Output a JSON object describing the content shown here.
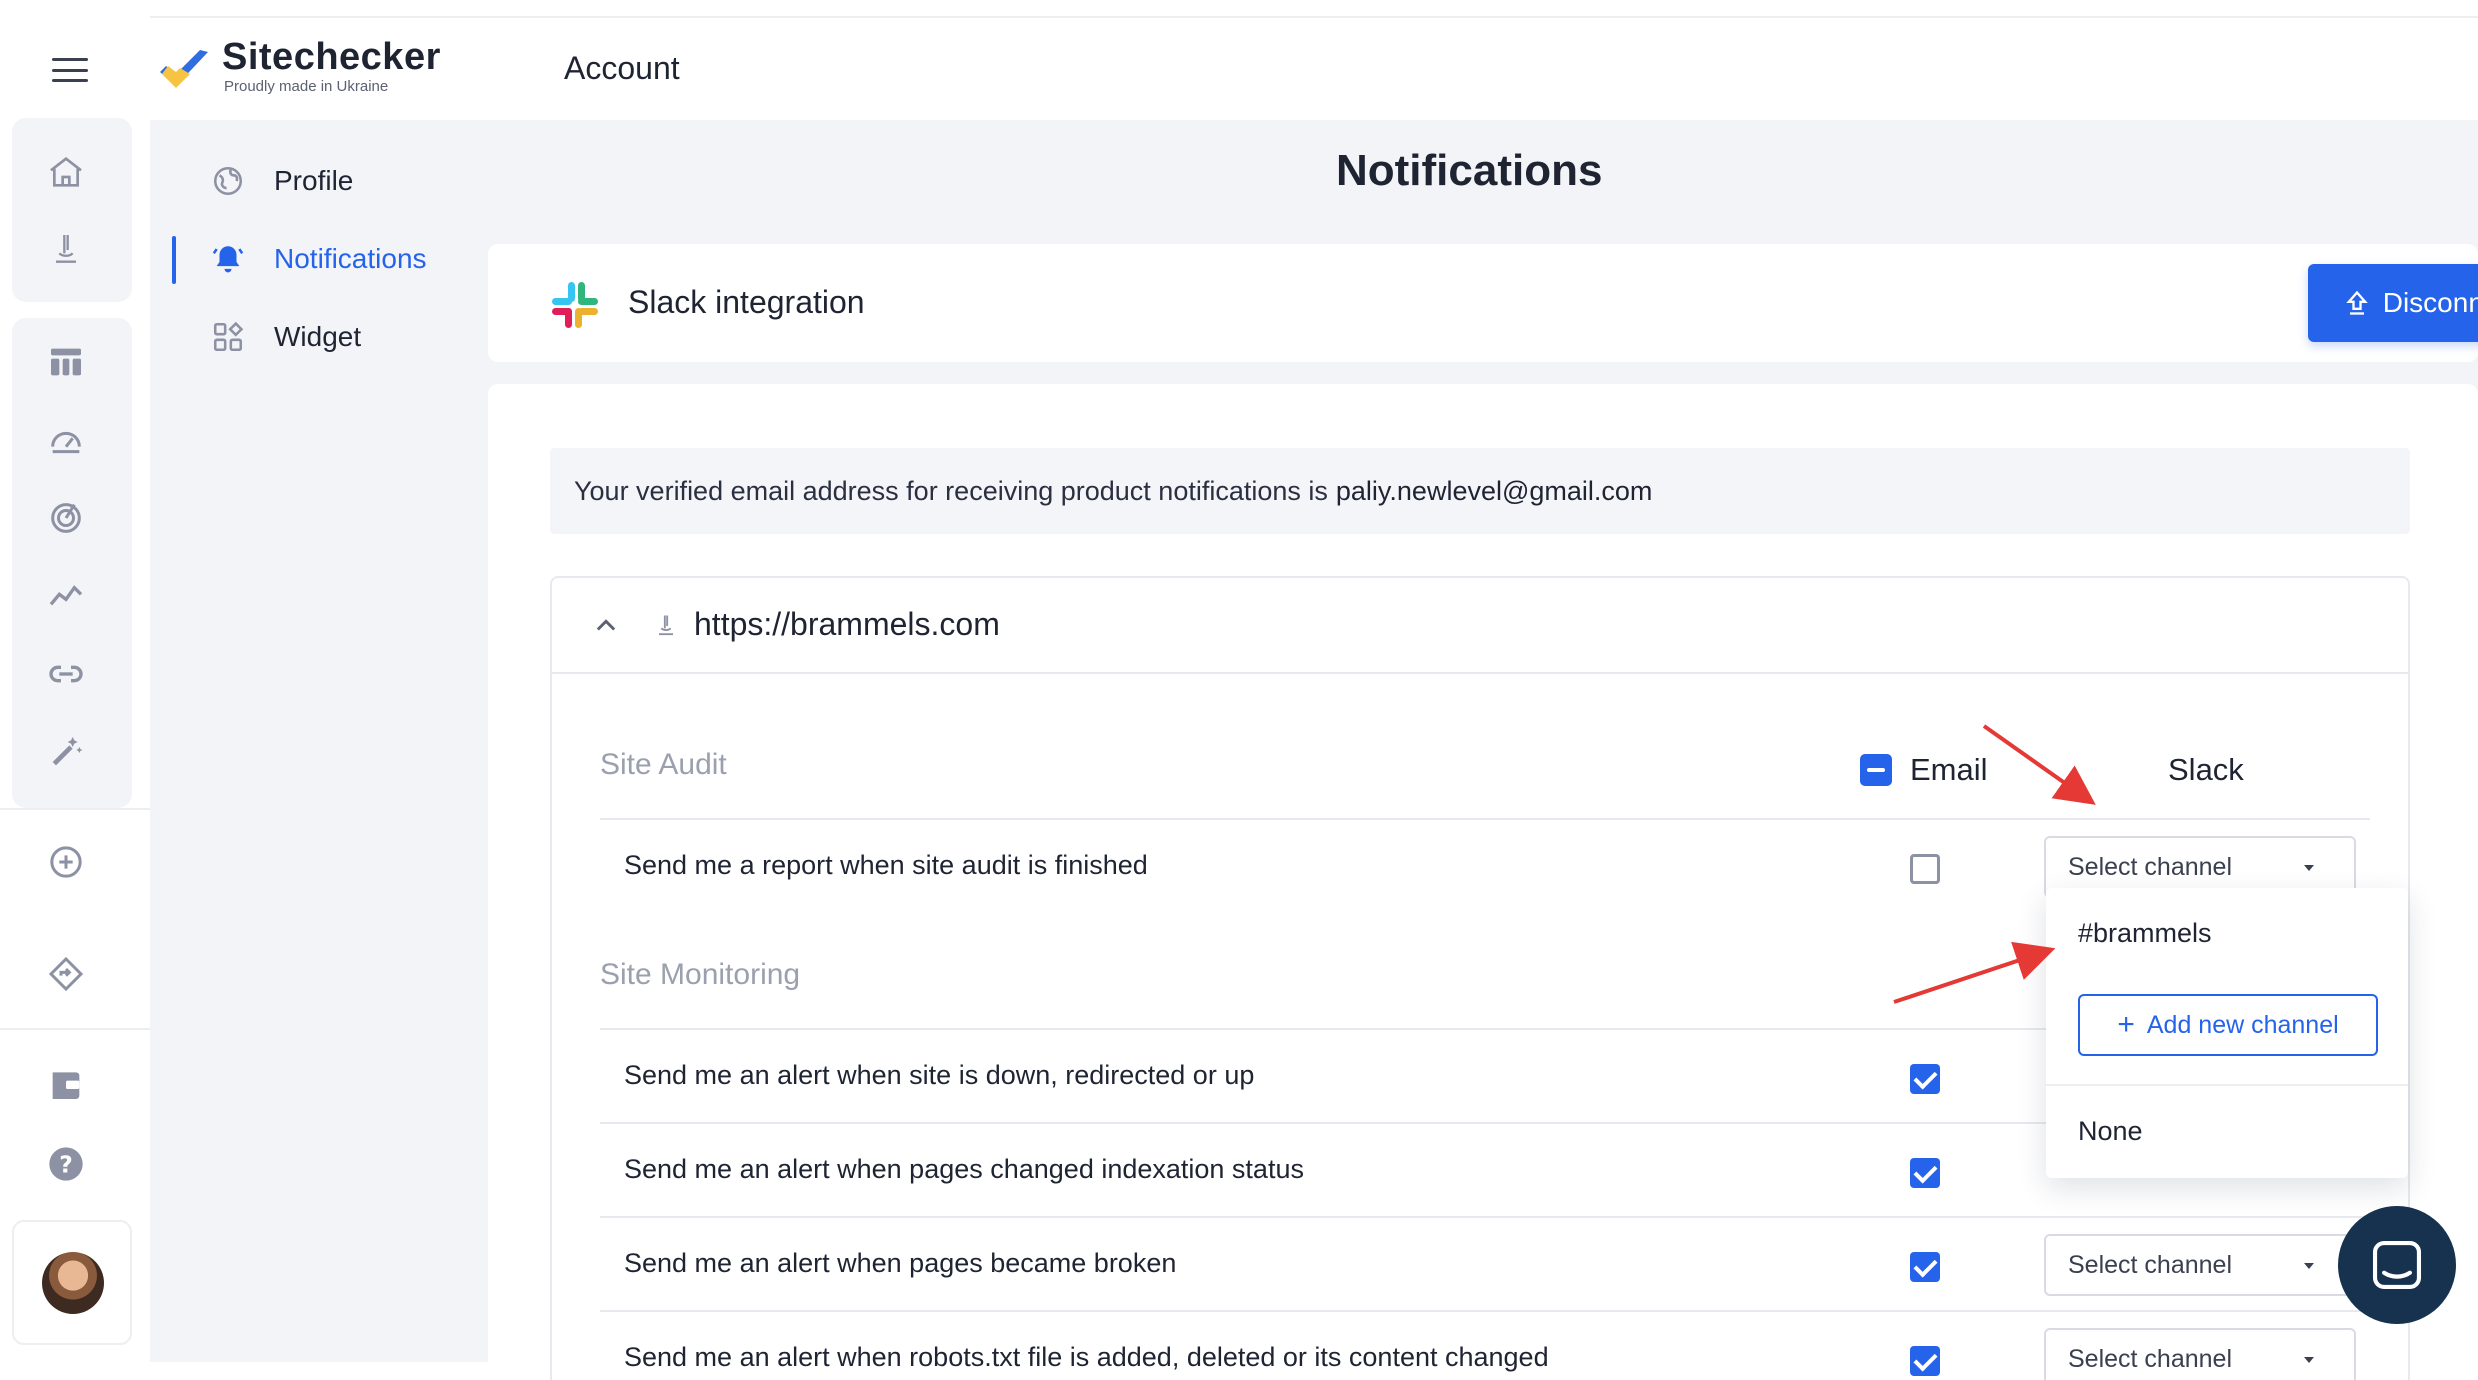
{
  "brand": {
    "name": "Sitechecker",
    "tagline": "Proudly made in Ukraine",
    "logo_colors": [
      "#2f6de1",
      "#f6c343"
    ]
  },
  "header": {
    "section": "Account"
  },
  "subnav": {
    "items": [
      {
        "label": "Profile",
        "icon": "globe-icon"
      },
      {
        "label": "Notifications",
        "icon": "bell-icon",
        "active": true
      },
      {
        "label": "Widget",
        "icon": "widget-icon"
      }
    ]
  },
  "page": {
    "title": "Notifications"
  },
  "slack": {
    "title": "Slack integration",
    "disconnect_label": "Disconnect"
  },
  "email_banner": {
    "text": "Your verified email address for receiving product notifications is",
    "email": "paliy.newlevel@gmail.com"
  },
  "site": {
    "url": "https://brammels.com",
    "columns": {
      "email": "Email",
      "slack": "Slack"
    },
    "sections": {
      "site_audit": "Site Audit",
      "site_monitoring": "Site Monitoring"
    },
    "rows": [
      {
        "text": "Send me a report when site audit is finished",
        "email_checked": false,
        "slack": "Select channel"
      },
      {
        "text": "Send me an alert when site is down, redirected or up",
        "email_checked": true,
        "slack": ""
      },
      {
        "text": "Send me an alert when pages changed indexation status",
        "email_checked": true,
        "slack": ""
      },
      {
        "text": "Send me an alert when pages became broken",
        "email_checked": true,
        "slack": "Select channel"
      },
      {
        "text": "Send me an alert when robots.txt file is added, deleted or its content changed",
        "email_checked": true,
        "slack": "Select channel"
      }
    ]
  },
  "dropdown": {
    "options": [
      "#brammels",
      "None"
    ],
    "add_label": "Add new channel"
  },
  "colors": {
    "accent": "#2563eb",
    "annotation_arrow": "#e53935",
    "chat": "#16324f"
  }
}
